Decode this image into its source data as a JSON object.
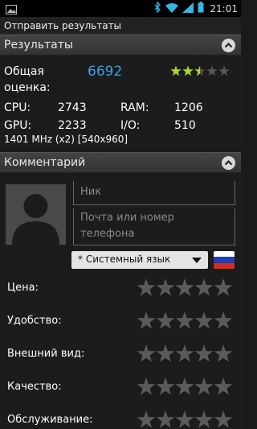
{
  "status_bar": {
    "time": "21:01",
    "icons": [
      "photo-icon",
      "bluetooth-icon",
      "wifi-icon",
      "signal-icon",
      "battery-icon"
    ]
  },
  "action_bar": {
    "title": "Отправить результаты"
  },
  "results": {
    "header": "Результаты",
    "total_label_line1": "Общая",
    "total_label_line2": "оценка:",
    "total_score": "6692",
    "rating": {
      "value": 2.5,
      "max": 5
    },
    "cpu_label": "CPU:",
    "cpu_value": "2743",
    "ram_label": "RAM:",
    "ram_value": "1206",
    "gpu_label": "GPU:",
    "gpu_value": "2233",
    "io_label": "I/O:",
    "io_value": "510",
    "device_info": "1401 MHz (x2) [540x960]"
  },
  "comment": {
    "header": "Комментарий",
    "nick_placeholder": "Ник",
    "contact_placeholder_line1": "Почта или номер",
    "contact_placeholder_line2": "телефона",
    "language_select": "* Системный язык",
    "criteria": [
      {
        "label": "Цена:",
        "rating": 0,
        "max": 5
      },
      {
        "label": "Удобство:",
        "rating": 0,
        "max": 5
      },
      {
        "label": "Внешний вид:",
        "rating": 0,
        "max": 5
      },
      {
        "label": "Качество:",
        "rating": 0,
        "max": 5
      },
      {
        "label": "Обслуживание:",
        "rating": 0,
        "max": 5
      }
    ]
  },
  "colors": {
    "accent": "#3aa0e6",
    "star_filled": "#a6d82c",
    "star_empty": "#555555",
    "big_star_empty": "#5a5a5a"
  }
}
